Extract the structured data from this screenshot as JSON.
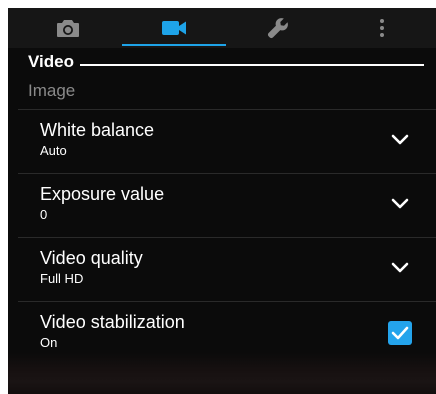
{
  "tabs": [
    {
      "icon": "camera-icon",
      "active": false
    },
    {
      "icon": "video-camera-icon",
      "active": true
    },
    {
      "icon": "wrench-icon",
      "active": false
    },
    {
      "icon": "more-vert-icon",
      "active": false
    }
  ],
  "colors": {
    "accent": "#1ea3e8",
    "background": "#0b0b0b",
    "text": "#ffffff",
    "muted": "#8a8a8a"
  },
  "section": {
    "title": "Video",
    "category": "Image"
  },
  "settings": [
    {
      "title": "White balance",
      "value": "Auto",
      "control": "dropdown"
    },
    {
      "title": "Exposure value",
      "value": "0",
      "control": "dropdown"
    },
    {
      "title": "Video quality",
      "value": "Full HD",
      "control": "dropdown"
    },
    {
      "title": "Video stabilization",
      "value": "On",
      "control": "checkbox",
      "checked": true
    }
  ]
}
